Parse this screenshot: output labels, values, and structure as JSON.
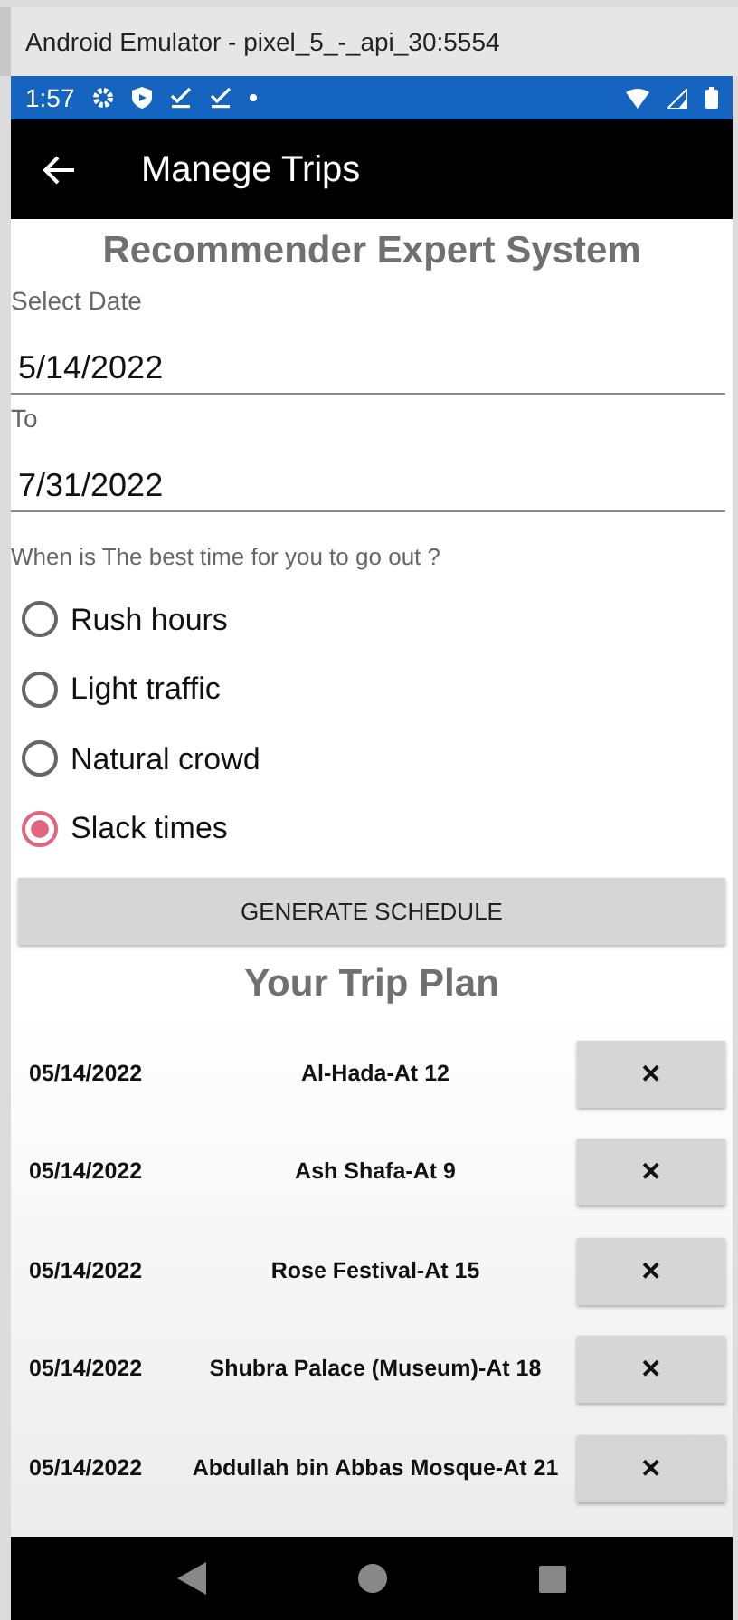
{
  "window": {
    "title": "Android Emulator - pixel_5_-_api_30:5554"
  },
  "status_bar": {
    "time": "1:57"
  },
  "app_bar": {
    "title": "Manege Trips"
  },
  "heading": "Recommender Expert System",
  "date_fields": [
    {
      "label": "Select Date",
      "value": "5/14/2022"
    },
    {
      "label": "To",
      "value": "7/31/2022"
    }
  ],
  "question": "When is The best time for you to go out ?",
  "options": [
    {
      "label": "Rush hours",
      "selected": false
    },
    {
      "label": "Light traffic",
      "selected": false
    },
    {
      "label": "Natural crowd",
      "selected": false
    },
    {
      "label": "Slack times",
      "selected": true
    }
  ],
  "generate_button": "GENERATE SCHEDULE",
  "plan_title": "Your Trip Plan",
  "trips": [
    {
      "date": "05/14/2022",
      "place": "Al-Hada-At 12",
      "remove": "✕"
    },
    {
      "date": "05/14/2022",
      "place": "Ash Shafa-At 9",
      "remove": "✕"
    },
    {
      "date": "05/14/2022",
      "place": "Rose Festival-At 15",
      "remove": "✕"
    },
    {
      "date": "05/14/2022",
      "place": "Shubra Palace (Museum)-At 18",
      "remove": "✕"
    },
    {
      "date": "05/14/2022",
      "place": "Abdullah bin Abbas Mosque-At 21",
      "remove": "✕"
    }
  ]
}
